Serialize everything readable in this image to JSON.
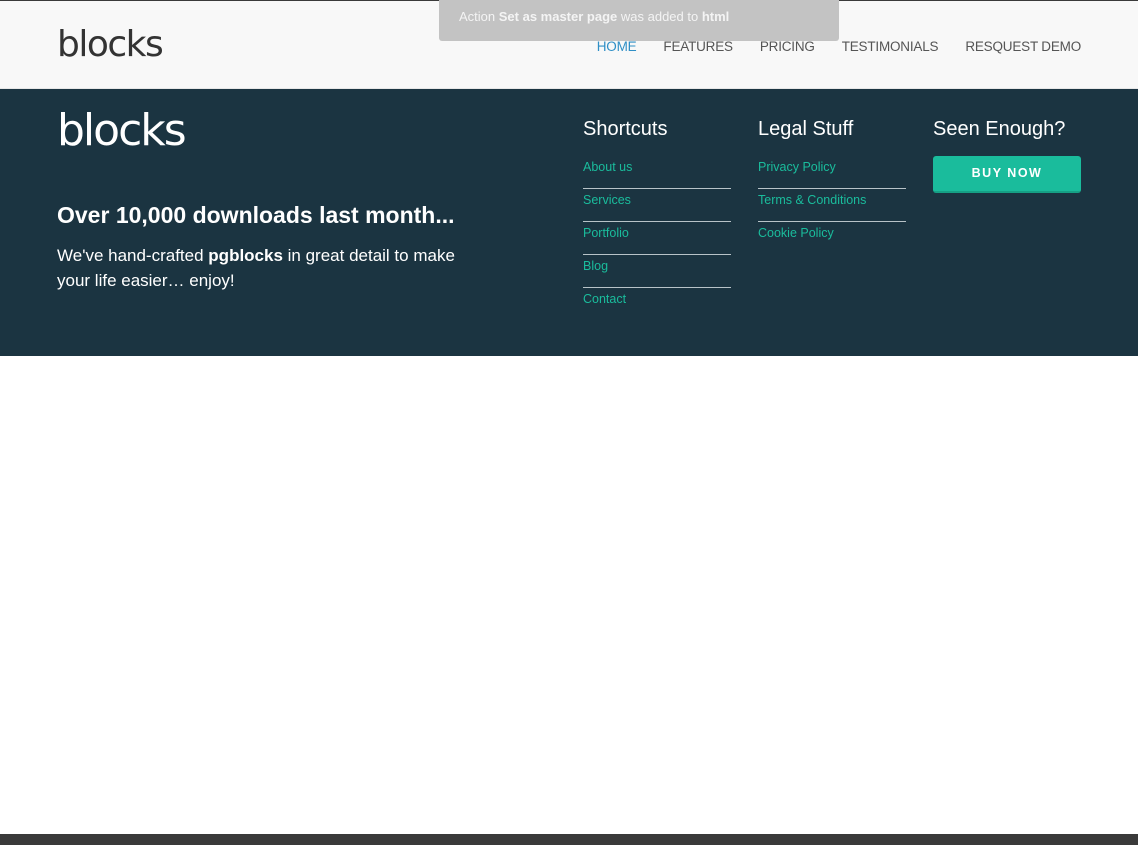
{
  "navbar": {
    "brand": "blocks",
    "items": [
      {
        "label": "HOME",
        "active": true
      },
      {
        "label": "FEATURES",
        "active": false
      },
      {
        "label": "PRICING",
        "active": false
      },
      {
        "label": "TESTIMONIALS",
        "active": false
      },
      {
        "label": "RESQUEST DEMO",
        "active": false
      }
    ]
  },
  "toast": {
    "prefix": "Action ",
    "action": "Set as master page",
    "middle": " was added to ",
    "target": "html"
  },
  "footer": {
    "brand": "blocks",
    "headline_pre": "Over ",
    "headline_num": "10,000",
    "headline_post": " downloads last month...",
    "text_pre": "We've hand-crafted ",
    "text_bold": "pgblocks",
    "text_post": " in great detail to make your life easier… enjoy!",
    "shortcuts": {
      "title": "Shortcuts",
      "links": [
        "About us",
        "Services",
        "Portfolio",
        "Blog",
        "Contact"
      ]
    },
    "legal": {
      "title": "Legal Stuff",
      "links": [
        "Privacy Policy",
        "Terms & Conditions",
        "Cookie Policy"
      ]
    },
    "seen": {
      "title": "Seen Enough?",
      "button": "BUY NOW"
    }
  },
  "colors": {
    "footer_bg": "#1b3441",
    "accent": "#1abc9c",
    "nav_active": "#2f8fc6",
    "navbar_bg": "#f8f8f8"
  }
}
